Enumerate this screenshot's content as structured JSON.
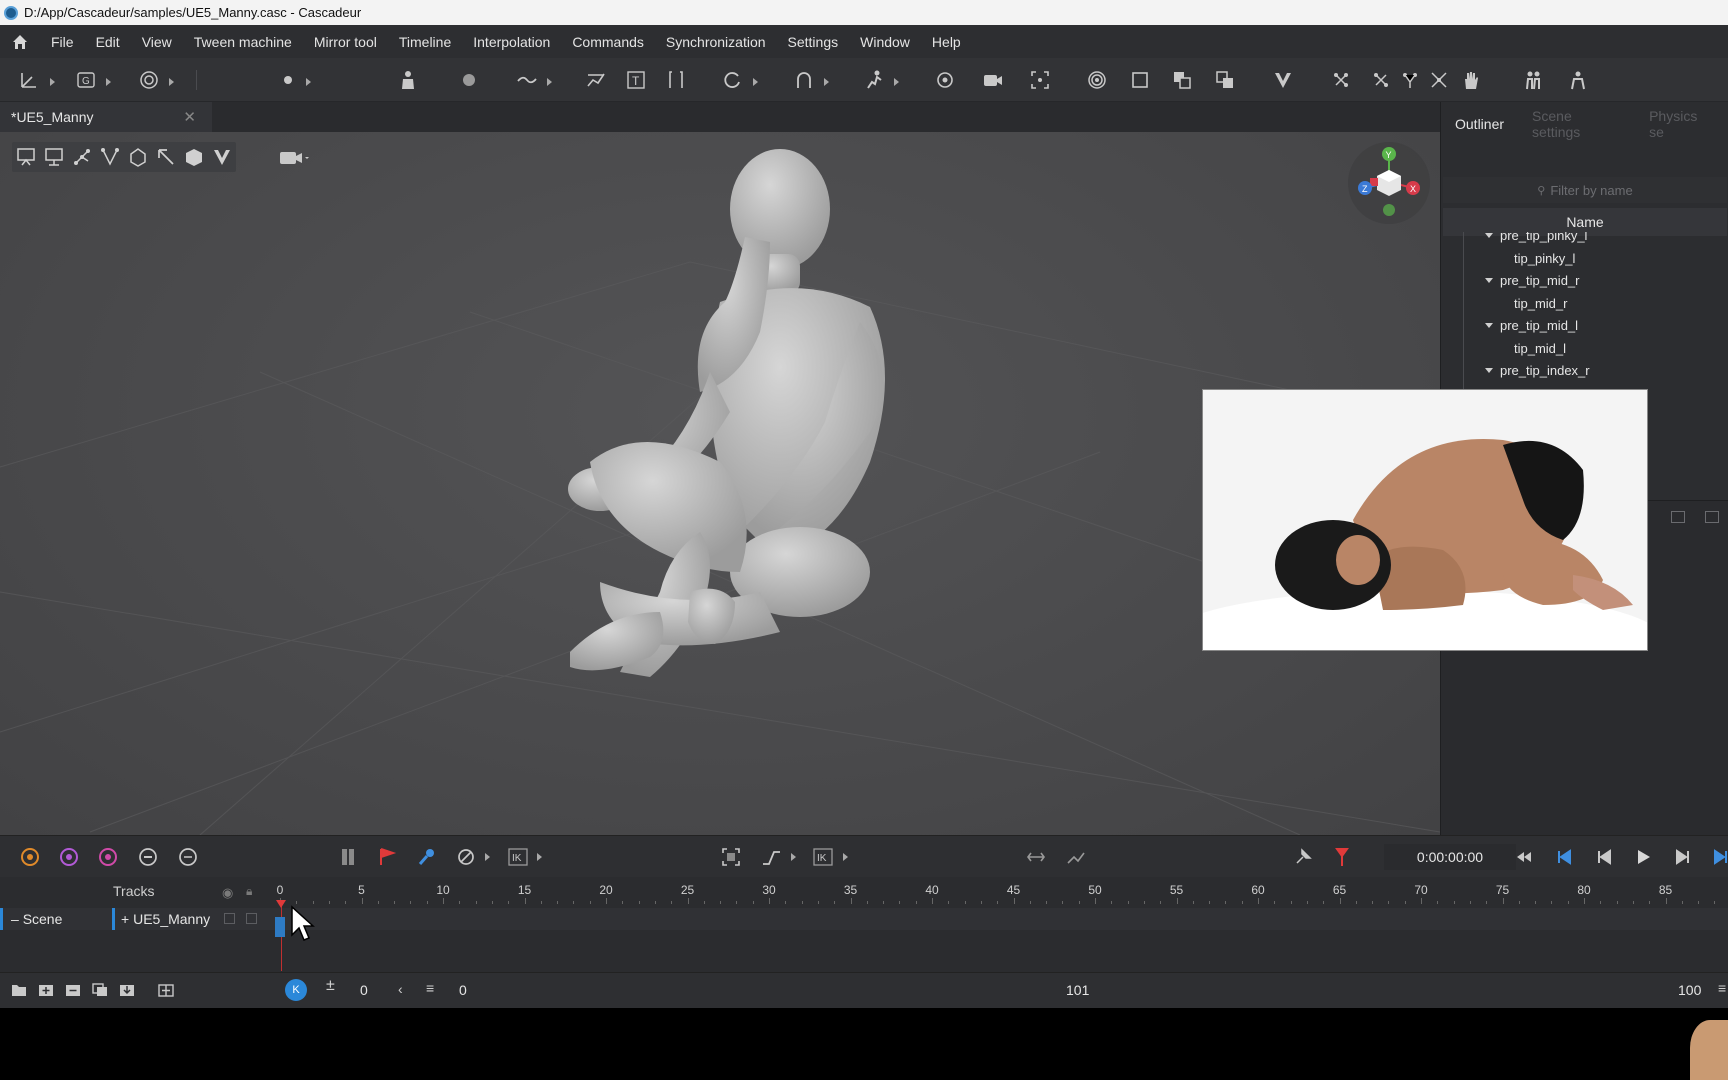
{
  "window": {
    "title": "D:/App/Cascadeur/samples/UE5_Manny.casc - Cascadeur"
  },
  "menu": [
    "File",
    "Edit",
    "View",
    "Tween machine",
    "Mirror tool",
    "Timeline",
    "Interpolation",
    "Commands",
    "Synchronization",
    "Settings",
    "Window",
    "Help"
  ],
  "document_tab": {
    "label": "*UE5_Manny"
  },
  "gizmo": {
    "y": "Y",
    "z": "Z",
    "x": "X"
  },
  "outliner": {
    "tabs": [
      "Outliner",
      "Scene settings",
      "Physics se"
    ],
    "filter_placeholder": "Filter by name",
    "column_header": "Name",
    "nodes": [
      {
        "label": "pre_tip_pinky_l",
        "expanded": true
      },
      {
        "label": "tip_pinky_l",
        "expanded": false
      },
      {
        "label": "pre_tip_mid_r",
        "expanded": true
      },
      {
        "label": "tip_mid_r",
        "expanded": false
      },
      {
        "label": "pre_tip_mid_l",
        "expanded": true
      },
      {
        "label": "tip_mid_l",
        "expanded": false
      },
      {
        "label": "pre_tip_index_r",
        "expanded": true
      }
    ]
  },
  "timeline": {
    "timecode": "0:00:00:00",
    "ik_label": "IK",
    "tracks_label": "Tracks",
    "ruler": [
      "0",
      "5",
      "10",
      "15",
      "20",
      "25",
      "30",
      "35",
      "40",
      "45",
      "50",
      "55",
      "60",
      "65",
      "70",
      "75",
      "80",
      "85"
    ],
    "scene_label": "Scene",
    "object_label": "UE5_Manny",
    "scene_prefix": "–",
    "object_prefix": "+"
  },
  "bottom": {
    "interval_start": "0",
    "current_frame": "0",
    "total_frames": "101",
    "end_frame": "100"
  },
  "colors": {
    "accent": "#2b88d9",
    "playhead": "#e03a3a",
    "background": "#4c4c4e"
  }
}
